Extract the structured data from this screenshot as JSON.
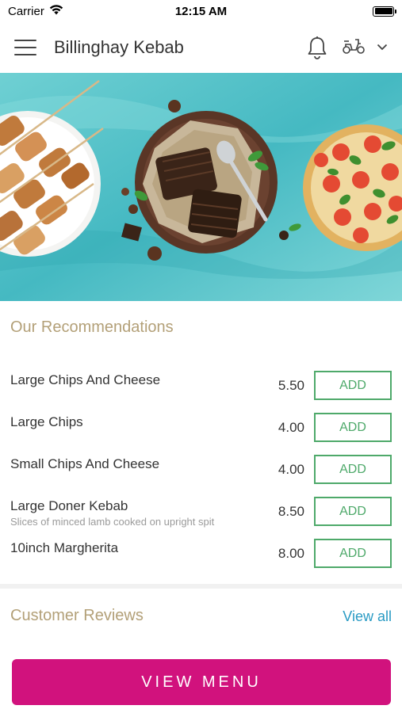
{
  "status_bar": {
    "carrier": "Carrier",
    "time": "12:15 AM"
  },
  "header": {
    "title": "Billinghay Kebab",
    "icons": [
      "menu-icon",
      "bell-icon",
      "scooter-icon",
      "chevron-down-icon"
    ]
  },
  "recommendations": {
    "title": "Our Recommendations",
    "items": [
      {
        "name": "Large Chips And Cheese",
        "description": "",
        "price": "5.50",
        "button": "ADD"
      },
      {
        "name": "Large Chips",
        "description": "",
        "price": "4.00",
        "button": "ADD"
      },
      {
        "name": "Small Chips And Cheese",
        "description": "",
        "price": "4.00",
        "button": "ADD"
      },
      {
        "name": "Large Doner Kebab",
        "description": "Slices of minced lamb cooked on upright spit",
        "price": "8.50",
        "button": "ADD"
      },
      {
        "name": "10inch Margherita",
        "description": "",
        "price": "8.00",
        "button": "ADD"
      }
    ]
  },
  "reviews": {
    "title": "Customer Reviews",
    "view_all": "View all"
  },
  "cta": {
    "label": "VIEW MENU"
  },
  "colors": {
    "accent": "#d1127d",
    "add_green": "#4ea96a",
    "section_title": "#b3a078",
    "link": "#2a9bc4",
    "hero_bg": "#57c6cc"
  }
}
